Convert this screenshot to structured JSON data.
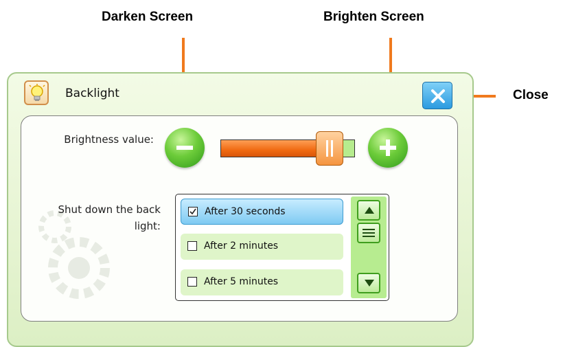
{
  "callouts": {
    "darken": "Darken Screen",
    "brighten": "Brighten Screen",
    "close": "Close"
  },
  "dialog": {
    "title": "Backlight",
    "title_icon": "lightbulb-icon",
    "close_icon": "close-x-icon"
  },
  "brightness": {
    "label": "Brightness value:",
    "decrease_icon": "minus-icon",
    "increase_icon": "plus-icon",
    "level": 0.78
  },
  "shutdown": {
    "label_line1": "Shut down the back",
    "label_line2": "light:",
    "options": [
      {
        "label": "After 30 seconds",
        "checked": true
      },
      {
        "label": "After 2 minutes",
        "checked": false
      },
      {
        "label": "After 5 minutes",
        "checked": false
      }
    ]
  },
  "colors": {
    "accent_orange": "#f07a1e",
    "button_green": "#6dcc3a",
    "close_blue": "#2c9be0",
    "selected_blue": "#7fcaf2"
  }
}
